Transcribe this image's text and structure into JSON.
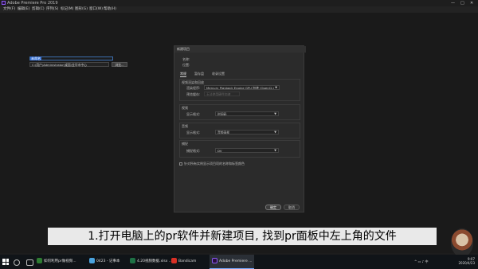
{
  "app": {
    "title": "Adobe Premiere Pro 2019",
    "logo_color": "#8b5cf6"
  },
  "window_controls": [
    "—",
    "□",
    "✕"
  ],
  "menu": [
    "文件(F)",
    "编辑(E)",
    "剪辑(C)",
    "序列(S)",
    "标记(M)",
    "图形(G)",
    "窗口(W)",
    "帮助(H)"
  ],
  "dialog": {
    "title": "新建项目",
    "name_label": "名称:",
    "name_value": "未命名",
    "location_label": "位置:",
    "location_value": "C:\\用户\\Administrator\\桌面\\金华市中心",
    "browse_label": "浏览...",
    "tabs": [
      "常规",
      "暂存盘",
      "收录设置"
    ],
    "renderer": {
      "section": "视频渲染和回放",
      "renderer_label": "渲染程序:",
      "renderer_value": "Mercury Playback Engine GPU 加速 (OpenCL)",
      "preview_cache_label": "预览缓存:",
      "preview_cache_value": "无法使用硬件加速"
    },
    "video": {
      "section": "视频",
      "display_label": "显示格式:",
      "display_value": "时间码"
    },
    "audio": {
      "section": "音频",
      "display_label": "显示格式:",
      "display_value": "音频采样"
    },
    "capture": {
      "section": "捕捉",
      "format_label": "捕捉格式:",
      "format_value": "DV"
    },
    "checkbox_label": "针对所有实例显示项目项的名称和标签颜色",
    "ok_label": "确定",
    "cancel_label": "取消"
  },
  "caption": "1.打开电脑上的pr软件并新建项目, 找到pr面板中左上角的文件",
  "taskbar": {
    "items": [
      {
        "label": "如何利用pr做视频...",
        "color": "#2e7d32"
      },
      {
        "label": "0423 - 记事本",
        "color": "#4aa3df"
      },
      {
        "label": "4.20视频数据.xlsx ...",
        "color": "#1e7145"
      },
      {
        "label": "Bandicam",
        "color": "#d93025"
      },
      {
        "label": "Adobe Premiere ...",
        "color": "#2a0d3f"
      }
    ],
    "time": "9:07",
    "date": "2020/4/23"
  }
}
